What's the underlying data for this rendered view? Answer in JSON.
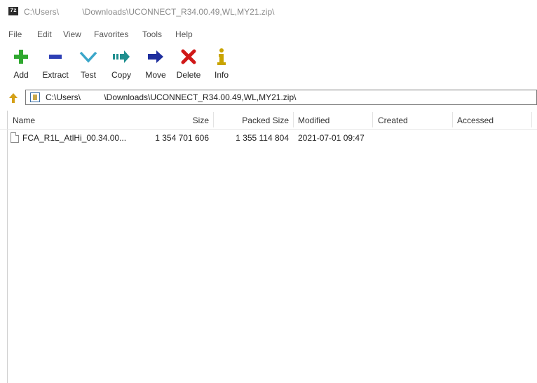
{
  "window": {
    "title": "C:\\Users\\          \\Downloads\\UCONNECT_R34.00.49,WL,MY21.zip\\",
    "icon": "7z-app-icon"
  },
  "menu": [
    "File",
    "Edit",
    "View",
    "Favorites",
    "Tools",
    "Help"
  ],
  "toolbar": {
    "add": "Add",
    "extract": "Extract",
    "test": "Test",
    "copy": "Copy",
    "move": "Move",
    "delete": "Delete",
    "info": "Info"
  },
  "address": {
    "path": "C:\\Users\\          \\Downloads\\UCONNECT_R34.00.49,WL,MY21.zip\\"
  },
  "columns": {
    "name": "Name",
    "size": "Size",
    "packed": "Packed Size",
    "modified": "Modified",
    "created": "Created",
    "accessed": "Accessed"
  },
  "files": [
    {
      "name": "FCA_R1L_AtlHi_00.34.00...",
      "size": "1 354 701 606",
      "packed": "1 355 114 804",
      "modified": "2021-07-01 09:47",
      "created": "",
      "accessed": ""
    }
  ],
  "colors": {
    "add": "#2fa82f",
    "extract": "#2d3fb5",
    "test": "#3aa6c9",
    "copy": "#1f8f8f",
    "move": "#1f2f9e",
    "delete": "#d01818",
    "info": "#c9a400"
  }
}
